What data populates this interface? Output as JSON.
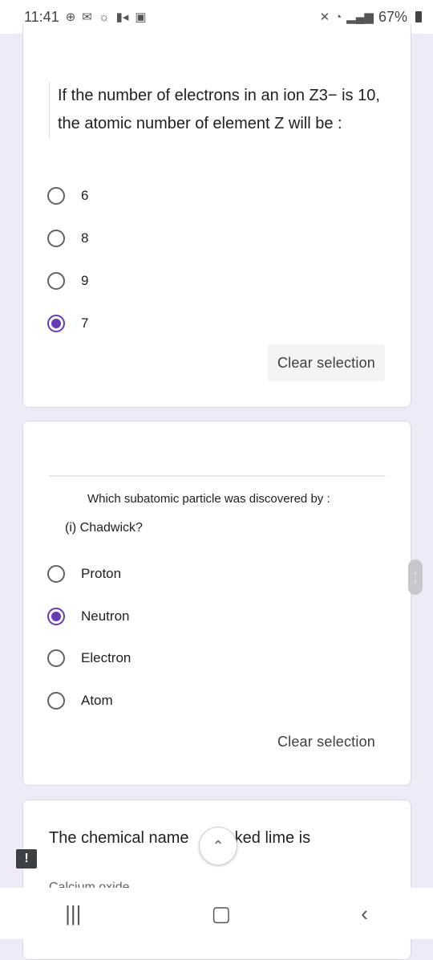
{
  "status": {
    "time": "11:41",
    "battery": "67%"
  },
  "q1": {
    "text": "If the number of electrons in an ion Z3− is 10, the atomic number of element Z will be :",
    "options": [
      "6",
      "8",
      "9",
      "7"
    ],
    "selected_index": 3,
    "clear": "Clear selection"
  },
  "q2": {
    "title": "Which subatomic particle was discovered by :",
    "subtitle": "(i) Chadwick?",
    "options": [
      "Proton",
      "Neutron",
      "Electron",
      "Atom"
    ],
    "selected_index": 1,
    "clear": "Clear selection"
  },
  "q3": {
    "text_start": "The chemical name",
    "text_end": "aked lime is",
    "option_partial": "Calcium oxide"
  },
  "icons": {
    "feedback": "exclamation-icon",
    "scroll_top": "chevron-up-icon",
    "nav": [
      "recent-apps-icon",
      "home-icon",
      "back-icon"
    ]
  },
  "colors": {
    "accent": "#673ab7",
    "background": "#efeaf8"
  }
}
